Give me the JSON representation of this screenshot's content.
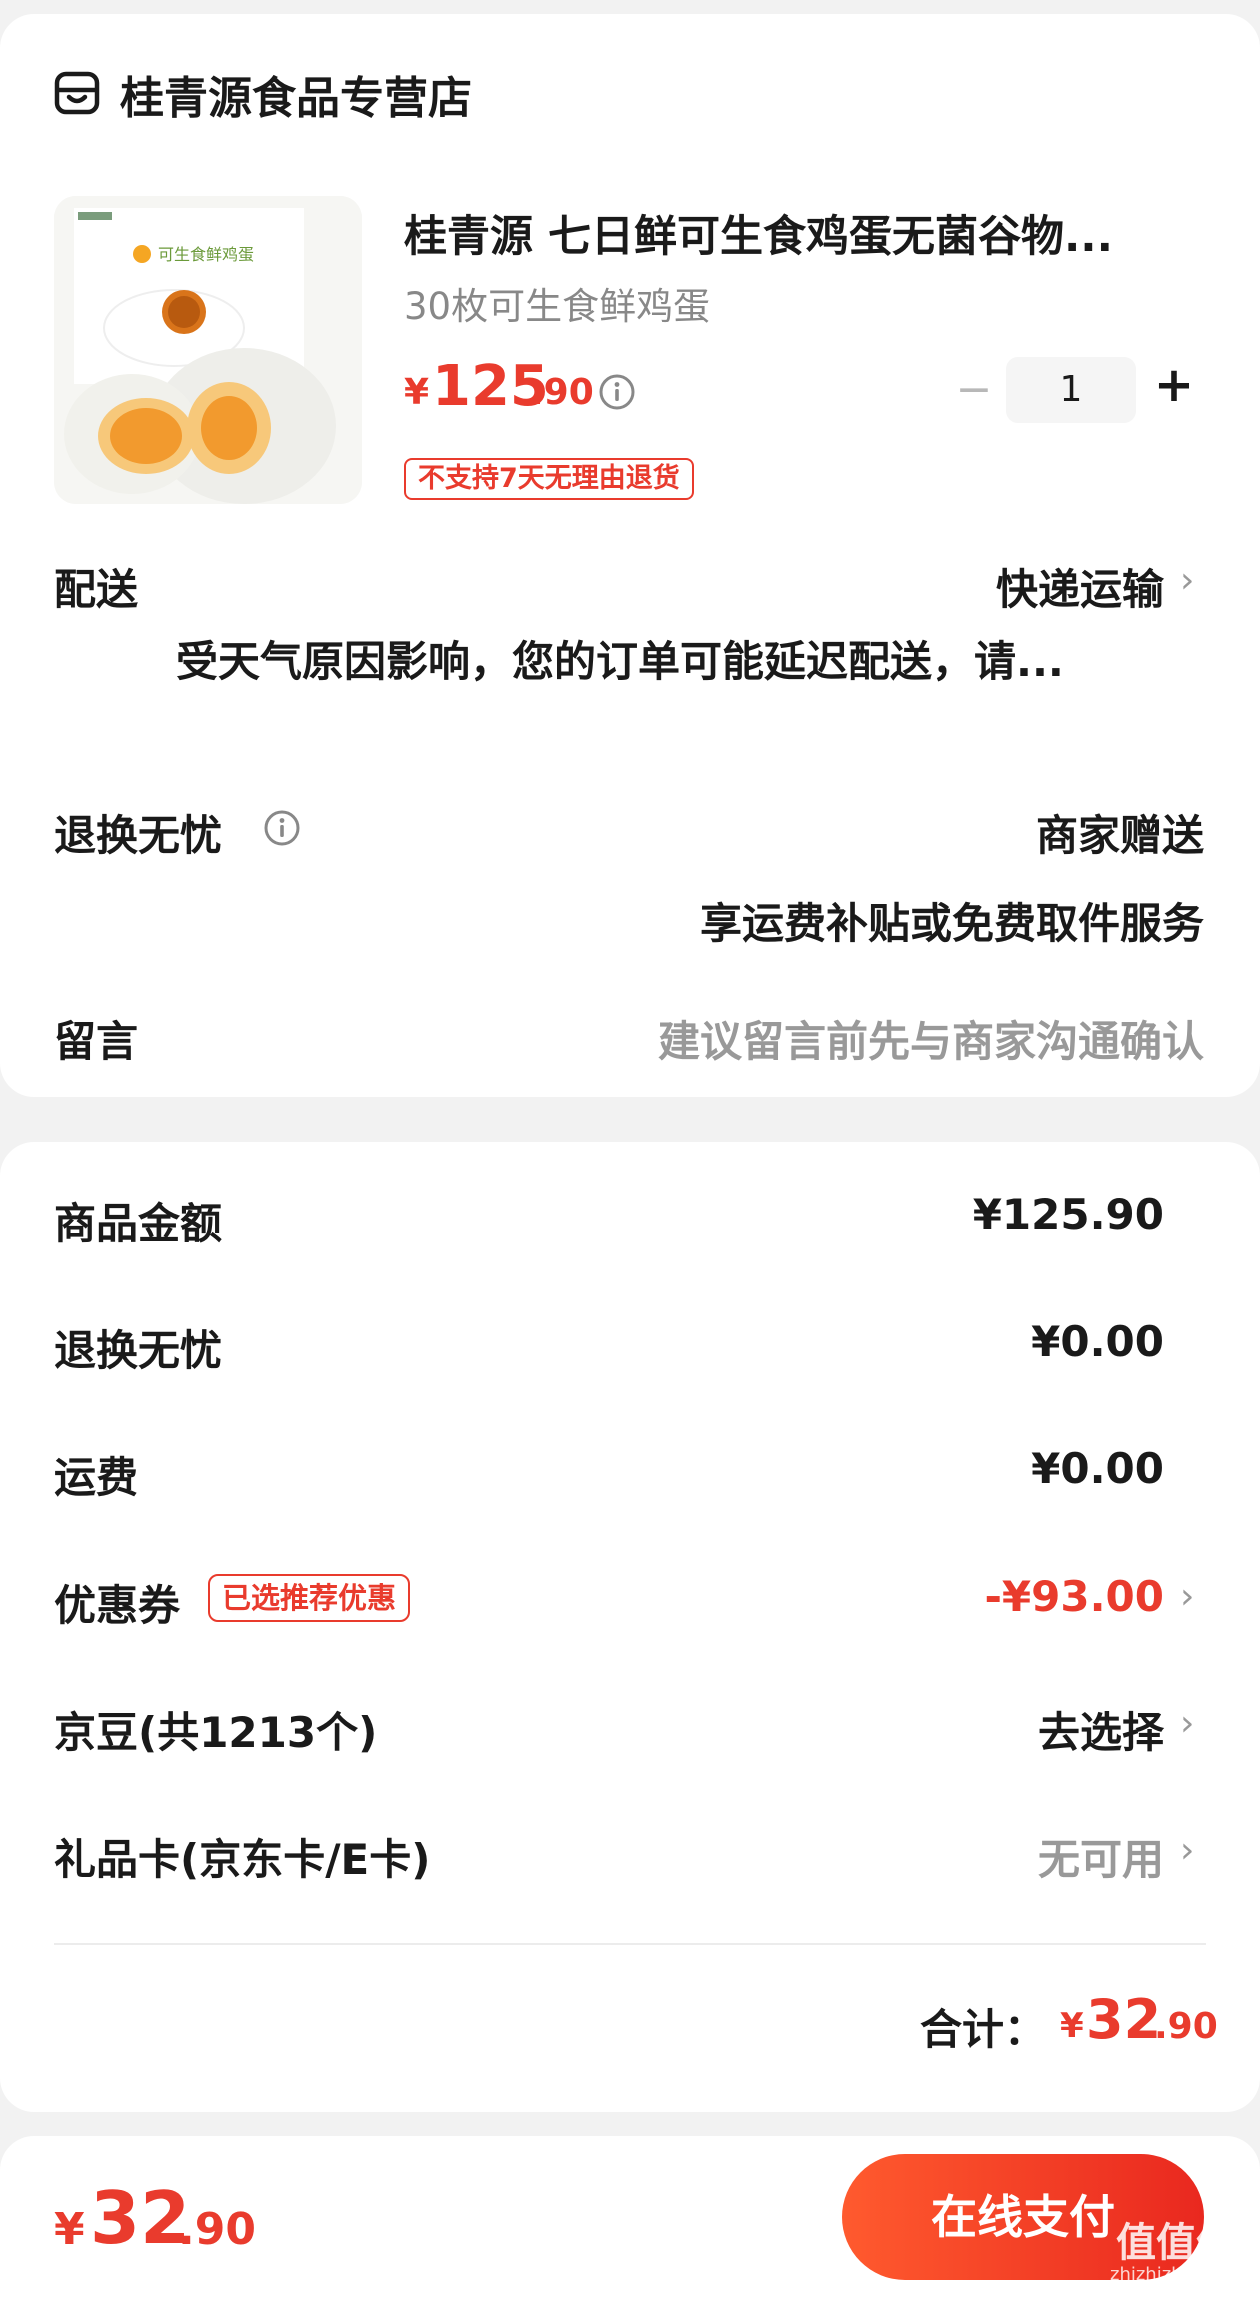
{
  "shop": {
    "name": "桂青源食品专营店",
    "icon": "shop-icon"
  },
  "product": {
    "image_alt": "可生食鲜鸡蛋 产品图",
    "image_caption": "可生食鲜鸡蛋",
    "title": "桂青源 七日鲜可生食鸡蛋无菌谷物...",
    "spec": "30枚可生食鲜鸡蛋",
    "price_symbol": "¥",
    "price_int": "125",
    "price_dec": ".90",
    "quantity": "1",
    "minus": "−",
    "plus": "+",
    "tag": "不支持7天无理由退货"
  },
  "delivery": {
    "label": "配送",
    "value": "快递运输",
    "notice": "受天气原因影响，您的订单可能延迟配送，请..."
  },
  "returns": {
    "label": "退换无忧",
    "value": "商家赠送",
    "sub": "享运费补贴或免费取件服务"
  },
  "message": {
    "label": "留言",
    "placeholder": "建议留言前先与商家沟通确认"
  },
  "summary": {
    "rows": [
      {
        "label": "商品金额",
        "value": "¥125.90"
      },
      {
        "label": "退换无忧",
        "value": "¥0.00"
      },
      {
        "label": "运费",
        "value": "¥0.00"
      },
      {
        "label": "优惠券",
        "tag": "已选推荐优惠",
        "value": "-¥93.00"
      },
      {
        "label": "京豆(共1213个)",
        "value": "去选择"
      },
      {
        "label": "礼品卡(京东卡/E卡)",
        "value": "无可用"
      }
    ],
    "total_label": "合计：",
    "total_symbol": "¥",
    "total_int": "32",
    "total_dec": ".90"
  },
  "bottom": {
    "symbol": "¥",
    "int": "32",
    "dec": ".90",
    "pay_label": "在线支付"
  },
  "watermark": {
    "main": "值值值",
    "sub": "zhizhizhi.com"
  },
  "colors": {
    "accent": "#e93b2d",
    "background": "#f2f2f2",
    "card": "#ffffff"
  }
}
